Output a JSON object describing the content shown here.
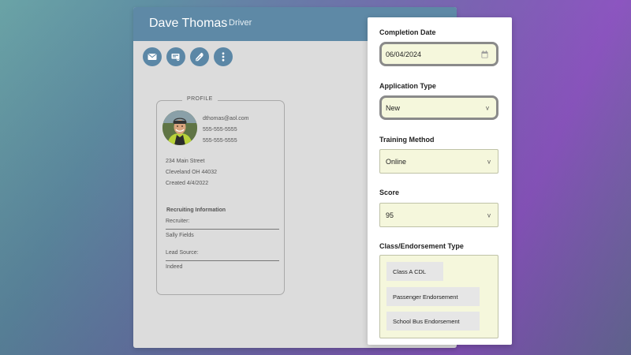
{
  "header": {
    "name": "Dave Thomas",
    "role": "Driver"
  },
  "actions": [
    {
      "icon": "mail-icon"
    },
    {
      "icon": "truck-icon"
    },
    {
      "icon": "edit-pen-icon"
    },
    {
      "icon": "more-vertical-icon"
    }
  ],
  "profile": {
    "legend": "PROFILE",
    "email": "dthomas@aol.com",
    "phone1": "555-555-5555",
    "phone2": "555-555-5555",
    "address1": "234 Main Street",
    "address2": "Cleveland OH 44032",
    "created": "Created 4/4/2022",
    "recruiting_heading": "Recruiting Information",
    "recruiter_label": "Recruiter:",
    "recruiter_value": "Sally Fields",
    "lead_source_label": "Lead Source:",
    "lead_source_value": "Indeed"
  },
  "form": {
    "completion_date": {
      "label": "Completion Date",
      "value": "06/04/2024",
      "icon": "calendar-icon"
    },
    "application_type": {
      "label": "Application Type",
      "value": "New"
    },
    "training_method": {
      "label": "Training Method",
      "value": "Online"
    },
    "score": {
      "label": "Score",
      "value": "95"
    },
    "class_endorsement": {
      "label": "Class/Endorsement Type",
      "chips": [
        "Class A CDL",
        "Passenger Endorsement",
        "School Bus Endorsement"
      ]
    },
    "chevron": "v"
  },
  "colors": {
    "header_bg": "#5e89a6",
    "action_btn": "#5b87a6",
    "field_bg": "#f5f7dc",
    "window_bg": "#dcdcdc"
  }
}
